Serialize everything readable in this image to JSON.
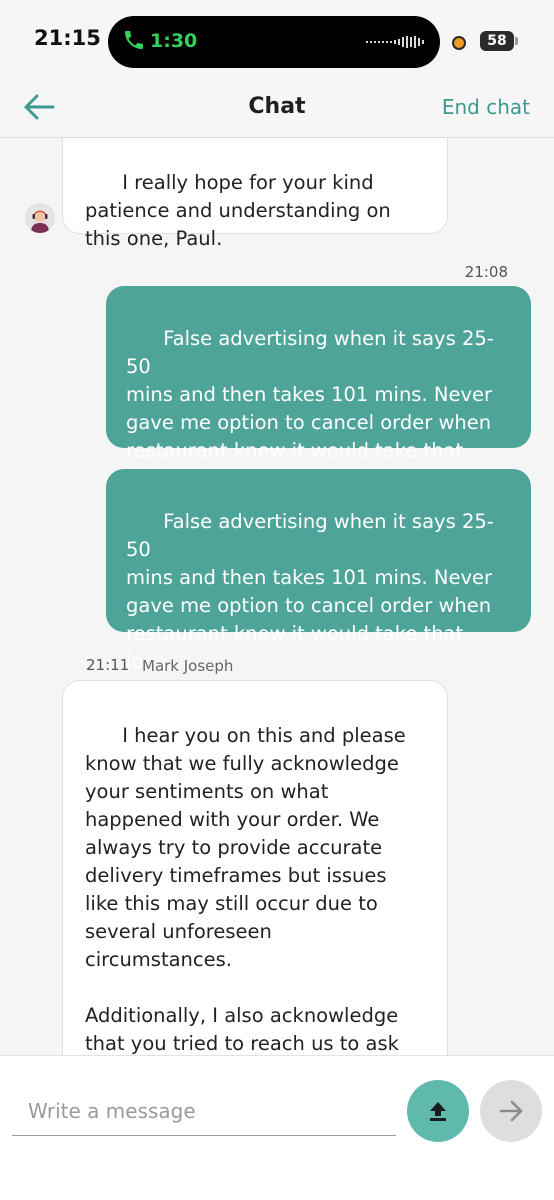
{
  "status_bar": {
    "time": "21:15",
    "call_timer": "1:30",
    "battery": "58"
  },
  "header": {
    "title": "Chat",
    "end_chat_label": "End chat"
  },
  "messages": [
    {
      "direction": "incoming",
      "text": "I really hope for your kind\npatience and understanding on\nthis one, Paul."
    },
    {
      "direction": "outgoing",
      "time": "21:08",
      "text": "False advertising when it says 25-50\nmins and then takes 101 mins. Never\ngave me option to cancel order when\nrestaurant knew it would take that\nlong."
    },
    {
      "direction": "outgoing",
      "text": "False advertising when it says 25-50\nmins and then takes 101 mins. Never\ngave me option to cancel order when\nrestaurant knew it would take that\nlong."
    },
    {
      "direction": "incoming",
      "time": "21:11",
      "sender": "Mark Joseph",
      "text": "I hear you on this and please\nknow that we fully acknowledge\nyour sentiments on what\nhappened with your order. We\nalways try to provide accurate\ndelivery timeframes but issues\nlike this may still occur due to\nseveral unforeseen\ncircumstances.\n\nAdditionally, I also acknowledge\nthat you tried to reach us to ask\nfor cancellation and to be honest,"
    }
  ],
  "composer": {
    "placeholder": "Write a message"
  },
  "icons": {
    "back": "arrow-left-icon",
    "upload": "upload-icon",
    "send": "arrow-right-icon",
    "call": "phone-icon"
  },
  "colors": {
    "accent": "#3c9a8e",
    "outgoing_bubble": "#4fa49a",
    "upload_button": "#5fb9ad",
    "send_button_disabled": "#dedede",
    "call_timer": "#35d05a"
  }
}
